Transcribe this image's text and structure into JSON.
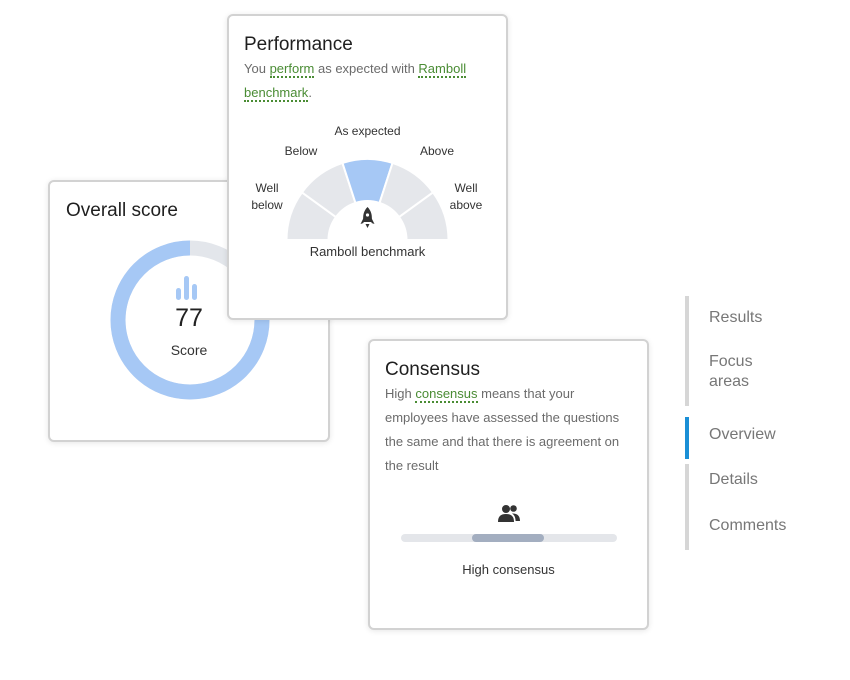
{
  "overall": {
    "title": "Overall score",
    "score": "77",
    "score_value": 77,
    "score_label": "Score",
    "icon": "bar-chart-icon",
    "colors": {
      "track": "#e3e6eb",
      "fill": "#a6c8f5",
      "icon": "#a6c8f5"
    }
  },
  "performance": {
    "title": "Performance",
    "desc_1": "You ",
    "term_perform": "perform",
    "desc_2": " as expected with ",
    "term_benchmark": "Ramboll benchmark",
    "desc_3": ".",
    "segments": [
      "Well below",
      "Below",
      "As expected",
      "Above",
      "Well above"
    ],
    "active_segment": 2,
    "center_icon": "rocket-icon",
    "benchmark_label": "Ramboll benchmark",
    "colors": {
      "segment": "#e5e7eb",
      "active": "#a6c8f5",
      "term": "#4a8c34"
    }
  },
  "consensus": {
    "title": "Consensus",
    "desc_1": "High ",
    "term": "consensus",
    "desc_2": " means that your employees have assessed the questions the same and that there is agreement on the result",
    "icon": "people-icon",
    "level_start": 0.33,
    "level_end": 0.66,
    "level_label": "High consensus",
    "colors": {
      "track": "#e4e6ea",
      "fill": "#a3aec0"
    }
  },
  "nav": {
    "items": [
      {
        "label": "Results",
        "active": false
      },
      {
        "label": "Focus areas",
        "active": false
      },
      {
        "label": "Overview",
        "active": true
      },
      {
        "label": "Details",
        "active": false
      },
      {
        "label": "Comments",
        "active": false
      }
    ],
    "colors": {
      "active": "#1a8fd6",
      "inactive": "#d6d6d6"
    }
  }
}
